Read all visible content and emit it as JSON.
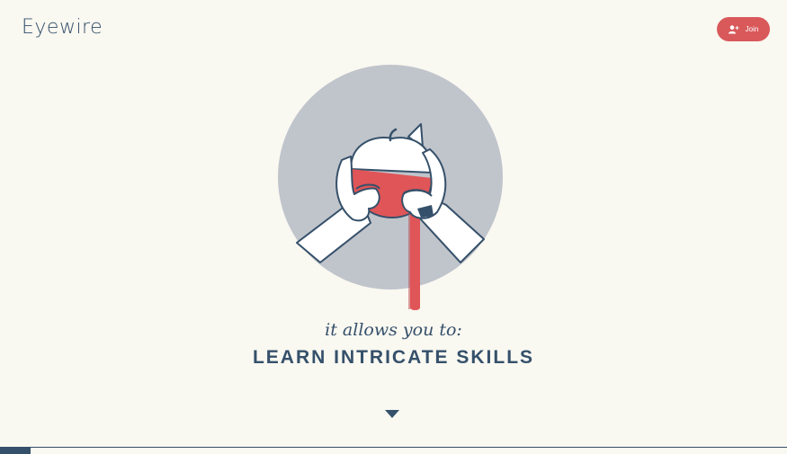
{
  "header": {
    "logo_text": "Eyewire",
    "join_label": "Join",
    "join_icon": "add-user-icon"
  },
  "hero": {
    "illustration": "hands-peeling-apple",
    "tagline": "it allows you to:",
    "headline": "LEARN INTRICATE SKILLS"
  },
  "scroll_icon": "chevron-down-icon",
  "progress": {
    "fraction": 0.039
  },
  "colors": {
    "background": "#f9f8f1",
    "navy": "#35506a",
    "accent_red": "#d9595b",
    "circle_gray": "#c0c4cb"
  }
}
